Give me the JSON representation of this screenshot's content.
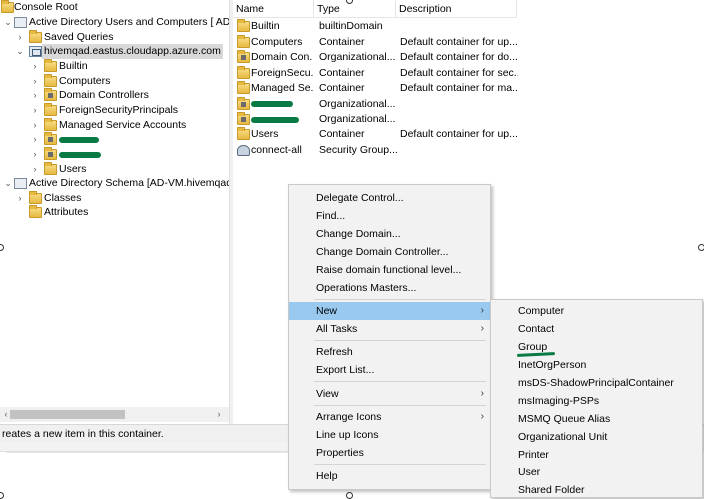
{
  "tree": {
    "items": [
      {
        "label": "Console Root"
      },
      {
        "label": "Active Directory Users and Computers [ AD-VM"
      },
      {
        "label": "Saved Queries"
      },
      {
        "label": "hivemqad.eastus.cloudapp.azure.com"
      },
      {
        "label": "Builtin"
      },
      {
        "label": "Computers"
      },
      {
        "label": "Domain Controllers"
      },
      {
        "label": "ForeignSecurityPrincipals"
      },
      {
        "label": "Managed Service Accounts"
      },
      {
        "label": "Users"
      },
      {
        "label": "Active Directory Schema [AD-VM.hivemqad.ea"
      },
      {
        "label": "Classes"
      },
      {
        "label": "Attributes"
      }
    ]
  },
  "list": {
    "columns": [
      "Name",
      "Type",
      "Description"
    ],
    "rows": [
      {
        "name": "Builtin",
        "type": "builtinDomain",
        "description": ""
      },
      {
        "name": "Computers",
        "type": "Container",
        "description": "Default container for up..."
      },
      {
        "name": "Domain Con...",
        "type": "Organizational...",
        "description": "Default container for do..."
      },
      {
        "name": "ForeignSecu...",
        "type": "Container",
        "description": "Default container for sec..."
      },
      {
        "name": "Managed Se...",
        "type": "Container",
        "description": "Default container for ma..."
      },
      {
        "name": "",
        "type": "Organizational...",
        "description": ""
      },
      {
        "name": "",
        "type": "Organizational...",
        "description": ""
      },
      {
        "name": "Users",
        "type": "Container",
        "description": "Default container for up..."
      },
      {
        "name": "connect-all",
        "type": "Security Group...",
        "description": ""
      }
    ]
  },
  "status": {
    "text": "reates a new item in this container."
  },
  "context_menu": {
    "items": [
      "Delegate Control...",
      "Find...",
      "Change Domain...",
      "Change Domain Controller...",
      "Raise domain functional level...",
      "Operations Masters...",
      "New",
      "All Tasks",
      "Refresh",
      "Export List...",
      "View",
      "Arrange Icons",
      "Line up Icons",
      "Properties",
      "Help"
    ]
  },
  "submenu": {
    "items": [
      "Computer",
      "Contact",
      "Group",
      "InetOrgPerson",
      "msDS-ShadowPrincipalContainer",
      "msImaging-PSPs",
      "MSMQ Queue Alias",
      "Organizational Unit",
      "Printer",
      "User",
      "Shared Folder"
    ]
  },
  "colors": {
    "menu_highlight": "#99c9ef",
    "annotation_green": "#0a7a45"
  }
}
